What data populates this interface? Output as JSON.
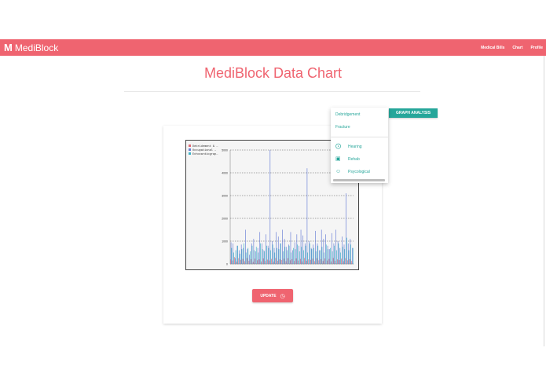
{
  "app": {
    "logo": "M",
    "name": "MediBlock"
  },
  "nav": {
    "links": [
      "Medical Bills",
      "Chart",
      "Profile"
    ]
  },
  "page": {
    "title": "MediBlock Data Chart"
  },
  "buttons": {
    "update": "UPDATE",
    "graph_analysis": "GRAPH ANALYSIS"
  },
  "icons": {
    "update": "clock-icon"
  },
  "dropdown": {
    "items": [
      {
        "label": "Debridgement",
        "icon": ""
      },
      {
        "label": "Fracture",
        "icon": ""
      },
      {
        "label": "Hearing",
        "icon": "ear-icon"
      },
      {
        "label": "Rehab",
        "icon": "rehab-icon"
      },
      {
        "label": "Psycological",
        "icon": "smiley-icon"
      }
    ]
  },
  "colors": {
    "brand": "#ef6470",
    "accent": "#26a69a"
  },
  "chart_data": {
    "type": "bar",
    "legend": [
      "Debridement & …",
      "Occupational …",
      "Echocardiograp…"
    ],
    "legend_position": "top-left",
    "series_colors": [
      "#e06c75",
      "#6a7fd6",
      "#3fb2c5"
    ],
    "yticks": [
      "0",
      "1000",
      "2000",
      "3000",
      "4000",
      "5000"
    ],
    "ylim": [
      0,
      5000
    ],
    "grid": true,
    "series": [
      {
        "name": "Debridement & …",
        "values": [
          200,
          150,
          300,
          100,
          250,
          180,
          220,
          120,
          260,
          140,
          210,
          90,
          230,
          160,
          200,
          110,
          240,
          130,
          190,
          150,
          220,
          100,
          260,
          140,
          200,
          170,
          230,
          120,
          250,
          160,
          210,
          130,
          240,
          150,
          220,
          110,
          260,
          140,
          200,
          180,
          230,
          120,
          250,
          160,
          210,
          130,
          240,
          150,
          220,
          110,
          260,
          140,
          200,
          170,
          230,
          120,
          250,
          160,
          210,
          130
        ]
      },
      {
        "name": "Occupational …",
        "values": [
          950,
          900,
          250,
          800,
          600,
          850,
          700,
          1500,
          650,
          400,
          900,
          1100,
          550,
          700,
          1400,
          900,
          600,
          1300,
          800,
          5000,
          1000,
          700,
          1400,
          1200,
          900,
          1500,
          1100,
          750,
          850,
          1400,
          600,
          950,
          1300,
          800,
          1500,
          1250,
          900,
          4200,
          1000,
          700,
          850,
          1450,
          900,
          600,
          1500,
          1100,
          1300,
          800,
          650,
          1350,
          900,
          1500,
          1000,
          700,
          1200,
          850,
          3100,
          900,
          1100,
          700
        ]
      },
      {
        "name": "Echocardiograp…",
        "values": [
          700,
          500,
          600,
          800,
          450,
          650,
          900,
          500,
          700,
          550,
          800,
          600,
          750,
          500,
          900,
          650,
          550,
          800,
          700,
          600,
          850,
          500,
          700,
          650,
          900,
          550,
          750,
          600,
          800,
          500,
          700,
          650,
          850,
          550,
          750,
          600,
          800,
          500,
          900,
          650,
          700,
          550,
          800,
          600,
          750,
          500,
          850,
          650,
          700,
          550,
          800,
          600,
          900,
          500,
          750,
          650,
          1150,
          600,
          850,
          700
        ]
      }
    ]
  }
}
